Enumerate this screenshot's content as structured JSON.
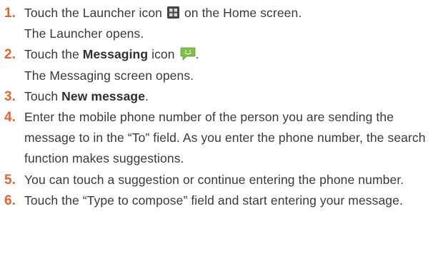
{
  "steps": [
    {
      "number": "1.",
      "before": "Touch the Launcher icon",
      "after": "on the Home screen.",
      "icon": "launcher-icon",
      "result": "The Launcher opens."
    },
    {
      "number": "2.",
      "before": "Touch the",
      "bold": "Messaging",
      "after": "icon",
      "icon": "messaging-icon",
      "trailing": ".",
      "result": "The Messaging screen opens."
    },
    {
      "number": "3.",
      "before": "Touch",
      "bold": "New message",
      "after": "."
    },
    {
      "number": "4.",
      "text": "Enter the mobile phone number of the person you are sending the message to in the “To” field. As you enter the phone number, the search function makes suggestions."
    },
    {
      "number": "5.",
      "text": "You can touch a suggestion or continue entering the phone number."
    },
    {
      "number": "6.",
      "text": "Touch the “Type to compose” field and start entering your message."
    }
  ],
  "colors": {
    "step_number": "#e8622a",
    "body_text": "#3a3a3a",
    "messaging_icon": "#7cc243"
  }
}
